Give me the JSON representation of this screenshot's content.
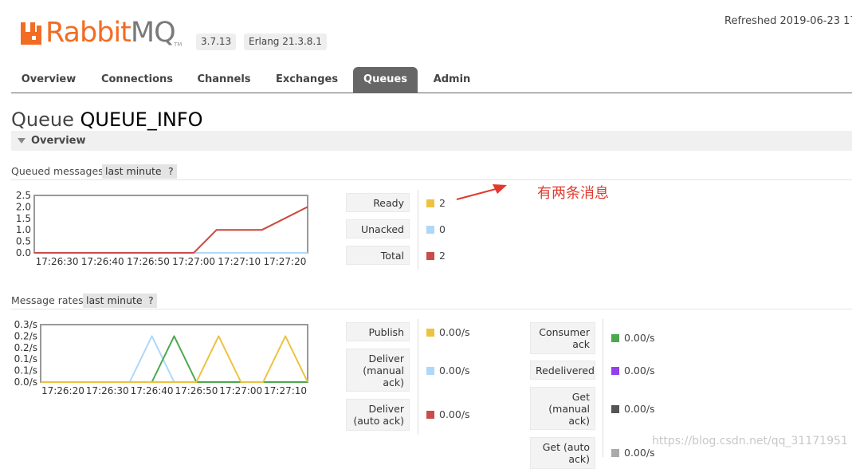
{
  "header": {
    "logo_rabbit": "Rabbit",
    "logo_mq": "MQ",
    "logo_tm": "TM",
    "version": "3.7.13",
    "erlang": "Erlang 21.3.8.1",
    "refreshed": "Refreshed 2019-06-23 17:"
  },
  "tabs": [
    {
      "label": "Overview",
      "active": false
    },
    {
      "label": "Connections",
      "active": false
    },
    {
      "label": "Channels",
      "active": false
    },
    {
      "label": "Exchanges",
      "active": false
    },
    {
      "label": "Queues",
      "active": true
    },
    {
      "label": "Admin",
      "active": false
    }
  ],
  "page": {
    "title_prefix": "Queue",
    "queue_name": "QUEUE_INFO"
  },
  "overview_section": {
    "label": "Overview"
  },
  "queued_messages": {
    "label": "Queued messages",
    "range": "last minute",
    "help": "?",
    "stats": [
      {
        "label": "Ready",
        "value": "2",
        "color": "#edc240"
      },
      {
        "label": "Unacked",
        "value": "0",
        "color": "#afd8f8"
      },
      {
        "label": "Total",
        "value": "2",
        "color": "#cb4b4b"
      }
    ]
  },
  "message_rates": {
    "label": "Message rates",
    "range": "last minute",
    "help": "?",
    "stats_left": [
      {
        "label": "Publish",
        "value": "0.00/s",
        "color": "#edc240"
      },
      {
        "label": "Deliver\n(manual\nack)",
        "value": "0.00/s",
        "color": "#afd8f8"
      },
      {
        "label": "Deliver\n(auto ack)",
        "value": "0.00/s",
        "color": "#cb4b4b"
      }
    ],
    "stats_right": [
      {
        "label": "Consumer\nack",
        "value": "0.00/s",
        "color": "#4da74d"
      },
      {
        "label": "Redelivered",
        "value": "0.00/s",
        "color": "#9440ed"
      },
      {
        "label": "Get\n(manual\nack)",
        "value": "0.00/s",
        "color": "#555555"
      },
      {
        "label": "Get (auto\nack)",
        "value": "0.00/s",
        "color": "#aaaaaa"
      }
    ]
  },
  "annotation": "有两条消息",
  "watermark": "https://blog.csdn.net/qq_31171951",
  "chart_data": [
    {
      "type": "line",
      "x": [
        "17:26:30",
        "17:26:40",
        "17:26:50",
        "17:27:00",
        "17:27:10",
        "17:27:20"
      ],
      "y_ticks": [
        "0.0",
        "0.5",
        "1.0",
        "1.5",
        "2.0",
        "2.5"
      ],
      "ylim": [
        0,
        2.5
      ],
      "x_range_seconds": [
        -60,
        0
      ],
      "series": [
        {
          "name": "Ready",
          "color": "#edc240",
          "points": [
            [
              -60,
              0
            ],
            [
              -25,
              0
            ],
            [
              -20,
              1
            ],
            [
              -10,
              1
            ],
            [
              0,
              2
            ]
          ]
        },
        {
          "name": "Unacked",
          "color": "#afd8f8",
          "points": [
            [
              -60,
              0
            ],
            [
              0,
              0
            ]
          ]
        },
        {
          "name": "Total",
          "color": "#cb4b4b",
          "points": [
            [
              -60,
              0
            ],
            [
              -25,
              0
            ],
            [
              -20,
              1
            ],
            [
              -10,
              1
            ],
            [
              0,
              2
            ]
          ]
        }
      ]
    },
    {
      "type": "line",
      "x": [
        "17:26:20",
        "17:26:30",
        "17:26:40",
        "17:26:50",
        "17:27:00",
        "17:27:10"
      ],
      "y_ticks": [
        "0.0/s",
        "0.1/s",
        "0.1/s",
        "0.2/s",
        "0.2/s",
        "0.3/s"
      ],
      "ylim": [
        0,
        0.25
      ],
      "x_range_seconds": [
        -65,
        -5
      ],
      "series": [
        {
          "name": "Deliver (manual ack)",
          "color": "#afd8f8",
          "points": [
            [
              -65,
              0
            ],
            [
              -45,
              0
            ],
            [
              -40,
              0.2
            ],
            [
              -35,
              0
            ],
            [
              -5,
              0
            ]
          ]
        },
        {
          "name": "Consumer ack",
          "color": "#4da74d",
          "points": [
            [
              -65,
              0
            ],
            [
              -40,
              0
            ],
            [
              -35,
              0.2
            ],
            [
              -30,
              0
            ],
            [
              -5,
              0
            ]
          ]
        },
        {
          "name": "Publish",
          "color": "#edc240",
          "points": [
            [
              -65,
              0
            ],
            [
              -30,
              0
            ],
            [
              -25,
              0.2
            ],
            [
              -20,
              0
            ],
            [
              -15,
              0
            ],
            [
              -10,
              0.2
            ],
            [
              -5,
              0
            ]
          ]
        }
      ]
    }
  ]
}
